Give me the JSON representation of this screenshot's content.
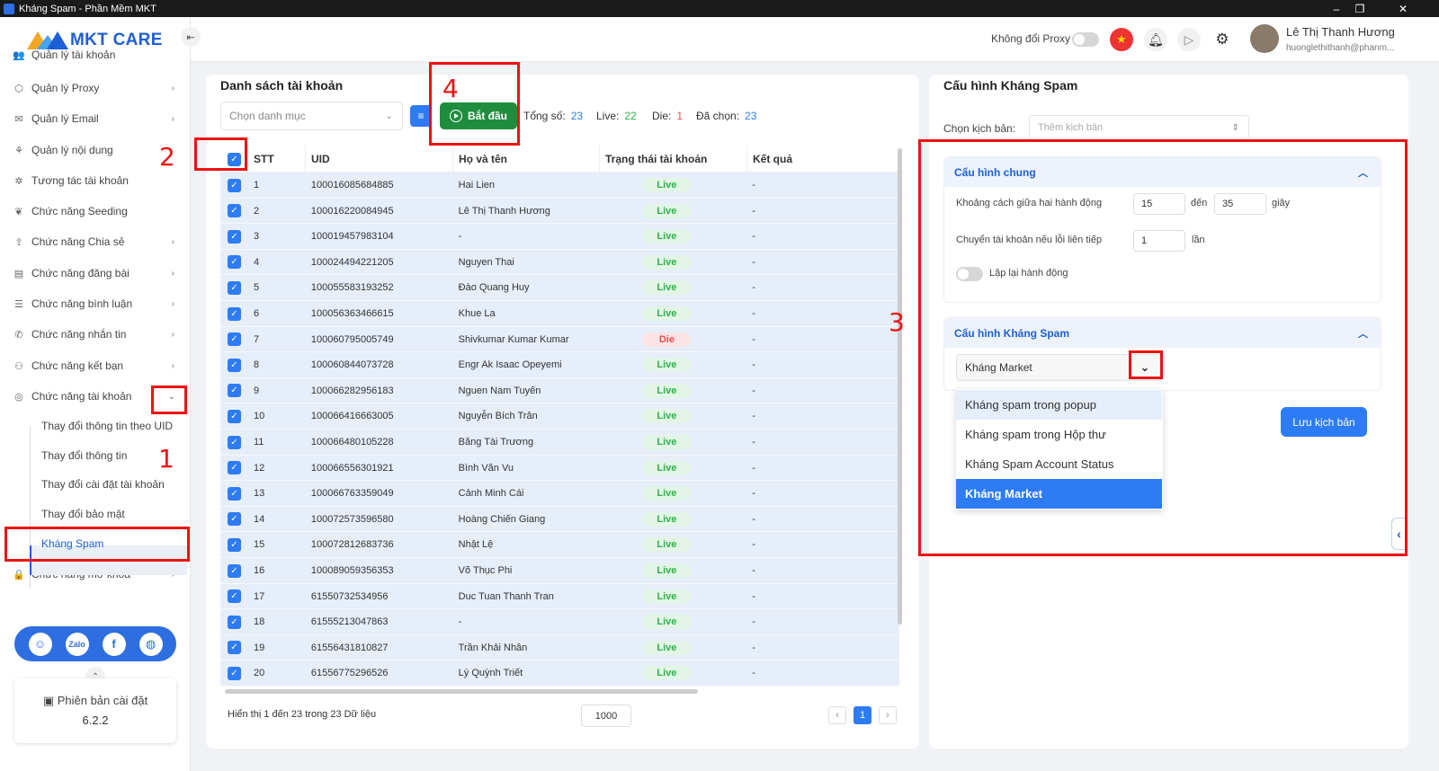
{
  "window": {
    "title": "Kháng Spam - Phần Mềm MKT",
    "controls": [
      "–",
      "❐",
      "✕"
    ]
  },
  "sidebar": {
    "logo_text": "MKT CARE",
    "items": [
      {
        "label": "Quản lý tài khoản",
        "icon": "users-icon",
        "chevron": false
      },
      {
        "label": "Quản lý Proxy",
        "icon": "proxy-icon",
        "chevron": true
      },
      {
        "label": "Quản lý Email",
        "icon": "email-icon",
        "chevron": true
      },
      {
        "label": "Quản lý nội dung",
        "icon": "content-icon",
        "chevron": false
      },
      {
        "label": "Tương tác tài khoản",
        "icon": "interact-icon",
        "chevron": false
      },
      {
        "label": "Chức năng Seeding",
        "icon": "seeding-icon",
        "chevron": false
      },
      {
        "label": "Chức năng Chia sẻ",
        "icon": "share-icon",
        "chevron": true
      },
      {
        "label": "Chức năng đăng bài",
        "icon": "post-icon",
        "chevron": true
      },
      {
        "label": "Chức năng bình luận",
        "icon": "comment-icon",
        "chevron": true
      },
      {
        "label": "Chức năng nhắn tin",
        "icon": "message-icon",
        "chevron": true
      },
      {
        "label": "Chức năng kết bạn",
        "icon": "add-friend-icon",
        "chevron": true
      },
      {
        "label": "Chức năng tài khoản",
        "icon": "account-icon",
        "chevron": true
      },
      {
        "label": "Chức năng mở khoá",
        "icon": "lock-icon",
        "chevron": true
      }
    ],
    "sub_items": [
      "Thay đổi thông tin theo UID",
      "Thay đổi thông tin",
      "Thay đổi cài đặt tài khoản",
      "Thay đổi bảo mật",
      "Kháng Spam"
    ],
    "version_label": "Phiên bản cài đặt",
    "version": "6.2.2"
  },
  "header": {
    "proxy_label": "Không đổi Proxy",
    "user_name": "Lê Thị Thanh Hương",
    "user_email": "huonglethithanh@phanm..."
  },
  "accounts": {
    "title": "Danh sách tài khoản",
    "category_placeholder": "Chọn danh mục",
    "start_label": "Bắt đầu",
    "stats": {
      "total_label": "Tổng số:",
      "total": "23",
      "live_label": "Live:",
      "live": "22",
      "die_label": "Die:",
      "die": "1",
      "selected_label": "Đã chọn:",
      "selected": "23"
    },
    "columns": [
      "STT",
      "UID",
      "Họ và tên",
      "Trạng thái tài khoản",
      "Kết quả"
    ],
    "rows": [
      {
        "stt": "1",
        "uid": "100016085684885",
        "name": "Hai Lien",
        "status": "Live",
        "result": "-"
      },
      {
        "stt": "2",
        "uid": "100016220084945",
        "name": "Lê Thị Thanh Hương",
        "status": "Live",
        "result": "-"
      },
      {
        "stt": "3",
        "uid": "100019457983104",
        "name": "-",
        "status": "Live",
        "result": "-"
      },
      {
        "stt": "4",
        "uid": "100024494221205",
        "name": "Nguyen Thai",
        "status": "Live",
        "result": "-"
      },
      {
        "stt": "5",
        "uid": "100055583193252",
        "name": "Đào Quang Huy",
        "status": "Live",
        "result": "-"
      },
      {
        "stt": "6",
        "uid": "100056363466615",
        "name": "Khue La",
        "status": "Live",
        "result": "-"
      },
      {
        "stt": "7",
        "uid": "100060795005749",
        "name": "Shivkumar Kumar Kumar",
        "status": "Die",
        "result": "-"
      },
      {
        "stt": "8",
        "uid": "100060844073728",
        "name": "Engr Ak Isaac Opeyemi",
        "status": "Live",
        "result": "-"
      },
      {
        "stt": "9",
        "uid": "100066282956183",
        "name": "Nguen Nam Tuyến",
        "status": "Live",
        "result": "-"
      },
      {
        "stt": "10",
        "uid": "100066416663005",
        "name": "Nguyễn Bích Trân",
        "status": "Live",
        "result": "-"
      },
      {
        "stt": "11",
        "uid": "100066480105228",
        "name": "Băng Tài Trương",
        "status": "Live",
        "result": "-"
      },
      {
        "stt": "12",
        "uid": "100066556301921",
        "name": "Bình Văn Vu",
        "status": "Live",
        "result": "-"
      },
      {
        "stt": "13",
        "uid": "100066763359049",
        "name": "Cảnh Minh Cái",
        "status": "Live",
        "result": "-"
      },
      {
        "stt": "14",
        "uid": "100072573596580",
        "name": "Hoàng Chiến Giang",
        "status": "Live",
        "result": "-"
      },
      {
        "stt": "15",
        "uid": "100072812683736",
        "name": "Nhật Lệ",
        "status": "Live",
        "result": "-"
      },
      {
        "stt": "16",
        "uid": "100089059356353",
        "name": "Võ Thục Phi",
        "status": "Live",
        "result": "-"
      },
      {
        "stt": "17",
        "uid": "61550732534956",
        "name": "Duc Tuan Thanh Tran",
        "status": "Live",
        "result": "-"
      },
      {
        "stt": "18",
        "uid": "61555213047863",
        "name": "-",
        "status": "Live",
        "result": "-"
      },
      {
        "stt": "19",
        "uid": "61556431810827",
        "name": "Trần Khải Nhân",
        "status": "Live",
        "result": "-"
      },
      {
        "stt": "20",
        "uid": "61556775296526",
        "name": "Lý Quỳnh Triết",
        "status": "Live",
        "result": "-"
      }
    ],
    "footer_text": "Hiển thị 1 đến 23 trong 23 Dữ liệu",
    "per_page": "1000",
    "current_page": "1",
    "prev": "‹",
    "next": "›"
  },
  "config": {
    "title": "Cấu hình Kháng Spam",
    "script_label": "Chọn kịch bản:",
    "script_placeholder": "Thêm kịch bản",
    "general": {
      "title": "Cấu hình chung",
      "interval_label": "Khoảng cách giữa hai hành động",
      "interval_from": "15",
      "to_label": "đến",
      "interval_to": "35",
      "seconds_label": "giây",
      "switch_label": "Chuyển tài khoản nếu lỗi liên tiếp",
      "switch_value": "1",
      "times_label": "lần",
      "repeat_label": "Lặp lại hành động"
    },
    "antispam": {
      "title": "Cấu hình Kháng Spam",
      "selected": "Kháng Market",
      "options": [
        "Kháng spam trong popup",
        "Kháng spam trong Hộp thư",
        "Kháng Spam Account Status",
        "Kháng Market"
      ]
    },
    "save_label": "Lưu kịch bản"
  },
  "annotations": [
    "1",
    "2",
    "3",
    "4"
  ],
  "colors": {
    "primary": "#2d7cf6",
    "start_green": "#1e8e3e",
    "annotation_red": "#ee1111",
    "row_bg": "#e6eef9"
  }
}
